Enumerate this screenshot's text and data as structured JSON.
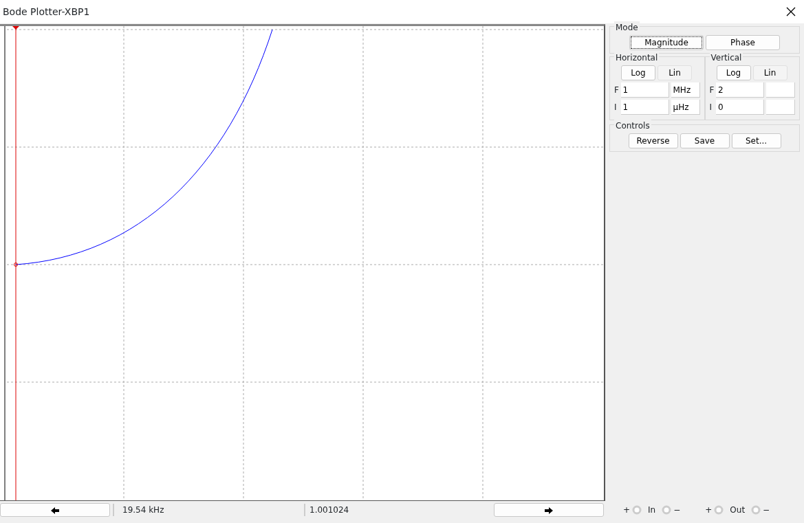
{
  "window": {
    "title": "Bode Plotter-XBP1"
  },
  "mode": {
    "label": "Mode",
    "buttons": [
      {
        "label": "Magnitude",
        "selected": true
      },
      {
        "label": "Phase",
        "selected": false
      }
    ]
  },
  "axes": [
    {
      "label": "Horizontal",
      "scales": [
        {
          "label": "Log",
          "selected": true
        },
        {
          "label": "Lin",
          "selected": false
        }
      ],
      "rows": [
        {
          "label": "F",
          "value": "1",
          "unit": "MHz"
        },
        {
          "label": "I",
          "value": "1",
          "unit": "μHz"
        }
      ]
    },
    {
      "label": "Vertical",
      "scales": [
        {
          "label": "Log",
          "selected": true
        },
        {
          "label": "Lin",
          "selected": false
        }
      ],
      "rows": [
        {
          "label": "F",
          "value": "2"
        },
        {
          "label": "I",
          "value": "0"
        }
      ]
    }
  ],
  "controls": {
    "label": "Controls",
    "buttons": [
      "Reverse",
      "Save",
      "Set..."
    ]
  },
  "status_bar": {
    "frequency": "19.54 kHz",
    "magnitude": "1.001024"
  },
  "terminals": [
    {
      "plus": "+",
      "label": "In",
      "minus": "−"
    },
    {
      "plus": "+",
      "label": "Out",
      "minus": "−"
    }
  ]
}
